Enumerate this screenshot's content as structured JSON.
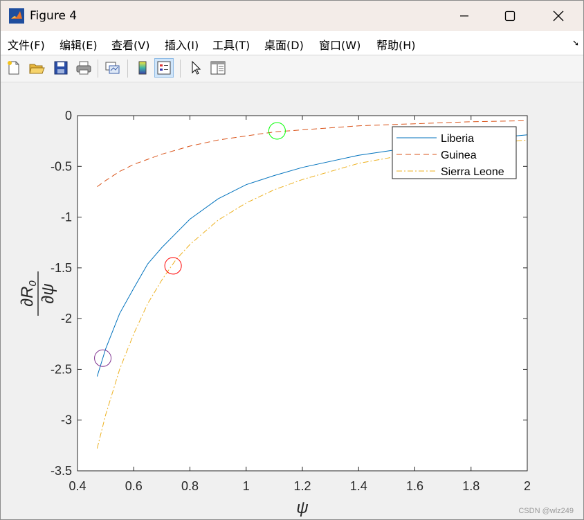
{
  "window": {
    "title": "Figure 4"
  },
  "menu": [
    "文件(F)",
    "编辑(E)",
    "查看(V)",
    "插入(I)",
    "工具(T)",
    "桌面(D)",
    "窗口(W)",
    "帮助(H)"
  ],
  "toolbar": [
    "new-figure-icon",
    "open-file-icon",
    "save-icon",
    "print-icon",
    "link-plot-icon",
    "colorbar-icon",
    "legend-icon",
    "pointer-icon",
    "property-editor-icon"
  ],
  "watermark": "CSDN @wlz249",
  "chart_data": {
    "type": "line",
    "xlabel": "ψ",
    "ylabel": "∂R0/∂ψ",
    "xlim": [
      0.4,
      2
    ],
    "ylim": [
      -3.5,
      0
    ],
    "xticks": [
      "0.4",
      "0.6",
      "0.8",
      "1",
      "1.2",
      "1.4",
      "1.6",
      "1.8",
      "2"
    ],
    "yticks": [
      "0",
      "-0.5",
      "-1",
      "-1.5",
      "-2",
      "-2.5",
      "-3",
      "-3.5"
    ],
    "grid": false,
    "legend_position": "top-right",
    "series": [
      {
        "name": "Liberia",
        "color": "#0072bd",
        "dash": "solid",
        "x": [
          0.47,
          0.5,
          0.55,
          0.6,
          0.65,
          0.7,
          0.8,
          0.9,
          1.0,
          1.1,
          1.2,
          1.4,
          1.6,
          1.8,
          2.0
        ],
        "y": [
          -2.57,
          -2.3,
          -1.95,
          -1.7,
          -1.46,
          -1.3,
          -1.02,
          -0.82,
          -0.68,
          -0.59,
          -0.51,
          -0.39,
          -0.31,
          -0.24,
          -0.19
        ]
      },
      {
        "name": "Guinea",
        "color": "#d95319",
        "dash": "dashed",
        "x": [
          0.47,
          0.5,
          0.55,
          0.6,
          0.7,
          0.8,
          0.9,
          1.0,
          1.1,
          1.2,
          1.4,
          1.6,
          1.8,
          2.0
        ],
        "y": [
          -0.7,
          -0.64,
          -0.55,
          -0.48,
          -0.38,
          -0.3,
          -0.24,
          -0.2,
          -0.16,
          -0.14,
          -0.1,
          -0.08,
          -0.06,
          -0.05
        ]
      },
      {
        "name": "Sierra Leone",
        "color": "#edb120",
        "dash": "dashdot",
        "x": [
          0.47,
          0.5,
          0.55,
          0.6,
          0.65,
          0.7,
          0.75,
          0.8,
          0.9,
          1.0,
          1.1,
          1.2,
          1.4,
          1.6,
          1.8,
          2.0
        ],
        "y": [
          -3.28,
          -2.95,
          -2.5,
          -2.15,
          -1.85,
          -1.62,
          -1.42,
          -1.27,
          -1.03,
          -0.86,
          -0.73,
          -0.63,
          -0.47,
          -0.37,
          -0.29,
          -0.24
        ]
      }
    ],
    "markers": [
      {
        "x": 0.49,
        "y": -2.39,
        "color": "#7e2f8e"
      },
      {
        "x": 0.74,
        "y": -1.48,
        "color": "#ff0000"
      },
      {
        "x": 1.11,
        "y": -0.15,
        "color": "#00ff00"
      }
    ]
  }
}
